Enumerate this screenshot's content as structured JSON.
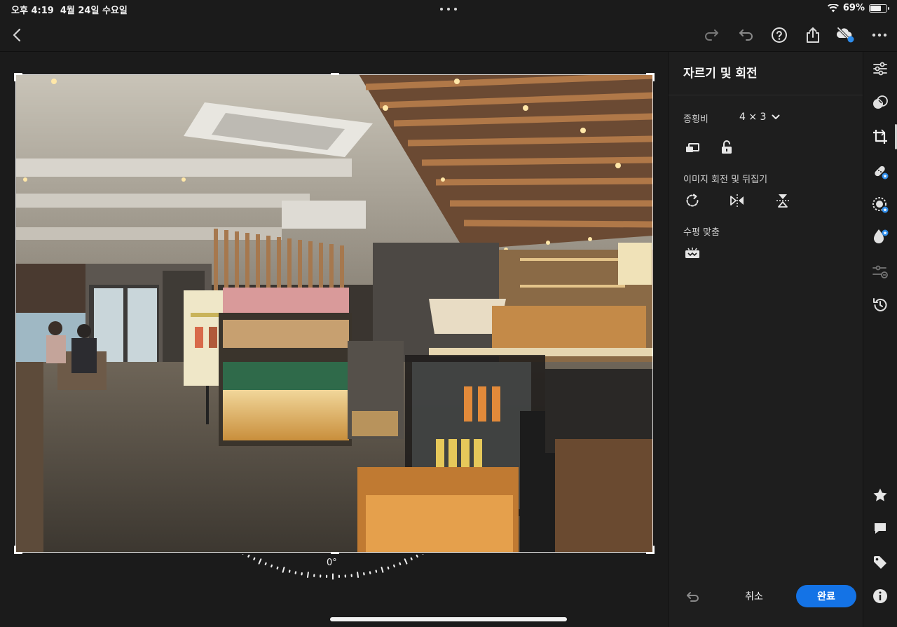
{
  "status_bar": {
    "time": "오후 4:19",
    "date": "4월 24일 수요일",
    "battery": "69%",
    "battery_level": 0.69
  },
  "toolbar": {
    "icons": [
      "back-icon",
      "redo-icon",
      "undo-icon",
      "help-icon",
      "share-icon",
      "cloud-sync-icon",
      "more-icon"
    ]
  },
  "crop": {
    "angle": "0°"
  },
  "panel": {
    "title": "자르기 및 회전",
    "aspect_label": "종횡비",
    "aspect_value": "4 × 3",
    "rotate_flip_label": "이미지 회전 및 뒤집기",
    "straighten_label": "수평 맞춤",
    "cancel": "취소",
    "done": "완료"
  },
  "colors": {
    "accent": "#1473e6",
    "background": "#1b1b1b",
    "panel": "#1e1e1e",
    "badge": "#2d8ceb"
  },
  "tool_strip": {
    "icons": [
      "edit-sliders-icon",
      "presets-icon",
      "crop-icon",
      "healing-icon",
      "masking-icon",
      "color-drop-icon",
      "versions-icon",
      "history-icon",
      "rating-icon",
      "comment-icon",
      "tag-icon",
      "info-icon"
    ],
    "active": "crop-icon"
  }
}
